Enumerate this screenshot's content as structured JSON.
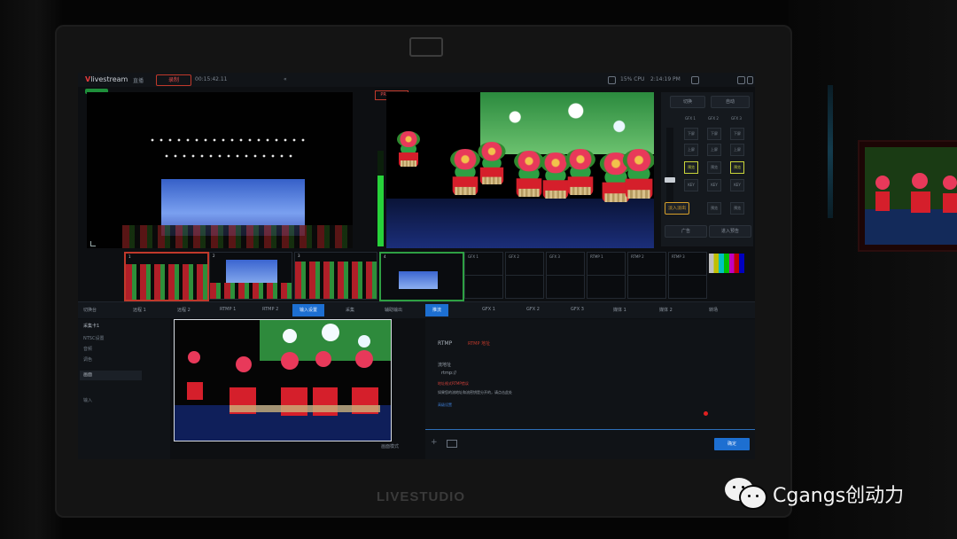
{
  "app": {
    "logo": "livestream",
    "top_items": [
      "直播",
      "录制",
      "00:15:42.11",
      "2:14:19 PM",
      "15% CPU"
    ],
    "rec_label": "录制"
  },
  "bezel": {
    "brand": "LIVESTUDIO"
  },
  "program": {
    "tag": "PROGRAM"
  },
  "controls": {
    "cut": "切换",
    "auto": "自动",
    "gfx": [
      "GFX 1",
      "GFX 2",
      "GFX 3"
    ],
    "down": "下屏",
    "up": "上屏",
    "on_air_btns": [
      "预览",
      "预览",
      "预览"
    ],
    "keys": [
      "KEY",
      "KEY",
      "KEY"
    ],
    "bottom": [
      "广告",
      "进入预告"
    ],
    "amber": "淡入淡出",
    "labels": [
      "预览",
      "预览"
    ]
  },
  "thumbs": {
    "labels": [
      "1",
      "2",
      "3",
      "4"
    ],
    "cells": [
      "GFX 1",
      "GFX 2",
      "GFX 3",
      "RTMP 1",
      "RTMP 2",
      "RTMP 3"
    ]
  },
  "tabs": [
    "切换台",
    "远程 1",
    "远程 2",
    "RTMP 1",
    "RTMP 2",
    "输入设置",
    "采集",
    "辅助输出",
    "推流",
    "GFX 1",
    "GFX 2",
    "GFX 3",
    "媒体 1",
    "媒体 2",
    "转场"
  ],
  "active_tabs": [
    "输入设置",
    "推流"
  ],
  "lower_left": {
    "title": "采集卡1",
    "items": [
      "NTSC设置",
      "音频",
      "调色",
      "画面",
      "输入"
    ]
  },
  "mode_label": "画面模式",
  "form": {
    "tab_rtmp": "RTMP",
    "tab_rtmp_alt": "RTMP 地址",
    "addr_label": "流地址",
    "addr_value": "rtmp://",
    "error_text": "地址格式RTMP错误",
    "hint_text": "如果您的流地址和流密钥是分开的，请点击此处",
    "advanced": "高级设置",
    "confirm": "确定"
  },
  "watermark": {
    "text": "Cgangs创动力"
  }
}
